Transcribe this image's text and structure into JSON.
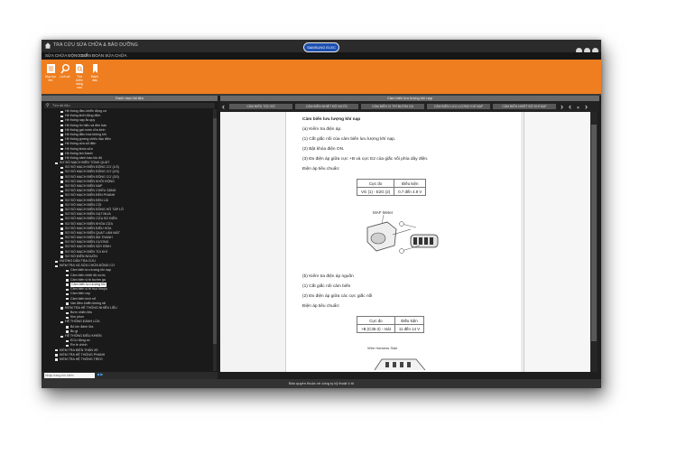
{
  "window": {
    "title": "TRA CỨU SỬA CHỮA & BẢO DƯỠNG",
    "brand_logo": "SAMSUNG ELEC",
    "controls": [
      "minimize",
      "maximize",
      "close"
    ]
  },
  "menu": [
    "SỬA CHỮA ĐỘNG CƠ",
    "CHẨN ĐOÁN SỬA CHỮA"
  ],
  "toolbar": [
    {
      "label": "Mục lục tìm",
      "icon": "book-icon"
    },
    {
      "label": "Lịch sử",
      "icon": "search-icon"
    },
    {
      "label": "Tìm kiếm nâng cao",
      "icon": "document-search-icon"
    },
    {
      "label": "Đánh dấu",
      "icon": "bookmark-icon"
    }
  ],
  "left_panel": {
    "header": "Danh mục tài liệu",
    "search_placeholder": "Tìm tài liệu",
    "footer_placeholder": "Nhập trang tìm kiếm"
  },
  "tree": [
    {
      "label": "Hệ thống điều khiển động cơ",
      "indent": 2
    },
    {
      "label": "Hệ thống khởi động điện",
      "indent": 2
    },
    {
      "label": "Hệ thống nạp ắc quy",
      "indent": 2
    },
    {
      "label": "Hệ thống tín hiệu và đèn báo",
      "indent": 2
    },
    {
      "label": "Hệ thống gạt nước rửa kính",
      "indent": 2
    },
    {
      "label": "Hệ thống điều hòa không khí",
      "indent": 2
    },
    {
      "label": "Hệ thống gương chiếu hậu điện",
      "indent": 2
    },
    {
      "label": "Hệ thống cửa sổ điện",
      "indent": 2
    },
    {
      "label": "Hệ thống khóa cửa",
      "indent": 2
    },
    {
      "label": "Hệ thống âm thanh",
      "indent": 2
    },
    {
      "label": "Hệ thống cảnh báo tốc độ",
      "indent": 2
    },
    {
      "label": "SƠ ĐỒ MẠCH ĐIỆN TỔNG QUÁT",
      "indent": 1
    },
    {
      "label": "SƠ ĐỒ MẠCH ĐIỆN ĐỘNG CƠ (1/3)",
      "indent": 2
    },
    {
      "label": "SƠ ĐỒ MẠCH ĐIỆN ĐỘNG CƠ (2/3)",
      "indent": 2
    },
    {
      "label": "SƠ ĐỒ MẠCH ĐIỆN ĐỘNG CƠ (3/3)",
      "indent": 2
    },
    {
      "label": "SƠ ĐỒ MẠCH ĐIỆN KHỞI ĐỘNG",
      "indent": 2
    },
    {
      "label": "SƠ ĐỒ MẠCH ĐIỆN NẠP",
      "indent": 2
    },
    {
      "label": "SƠ ĐỒ MẠCH ĐIỆN CHIẾU SÁNG",
      "indent": 2
    },
    {
      "label": "SƠ ĐỒ MẠCH ĐIỆN ĐÈN PHANH",
      "indent": 2
    },
    {
      "label": "SƠ ĐỒ MẠCH ĐIỆN ĐÈN LÙI",
      "indent": 2
    },
    {
      "label": "SƠ ĐỒ MẠCH ĐIỆN CÒI",
      "indent": 2
    },
    {
      "label": "SƠ ĐỒ MẠCH ĐIỆN ĐỒNG HỒ TÁP LÔ",
      "indent": 2
    },
    {
      "label": "SƠ ĐỒ MẠCH ĐIỆN GẠT MƯA",
      "indent": 2
    },
    {
      "label": "SƠ ĐỒ MẠCH ĐIỆN CỬA SỔ ĐIỆN",
      "indent": 2
    },
    {
      "label": "SƠ ĐỒ MẠCH ĐIỆN KHÓA CỬA",
      "indent": 2
    },
    {
      "label": "SƠ ĐỒ MẠCH ĐIỆN ĐIỀU HÒA",
      "indent": 2
    },
    {
      "label": "SƠ ĐỒ MẠCH ĐIỆN QUẠT LÀM MÁT",
      "indent": 2
    },
    {
      "label": "SƠ ĐỒ MẠCH ĐIỆN ÂM THANH",
      "indent": 2
    },
    {
      "label": "SƠ ĐỒ MẠCH ĐIỆN GƯƠNG",
      "indent": 2
    },
    {
      "label": "SƠ ĐỒ MẠCH ĐIỆN SẤY KÍNH",
      "indent": 2
    },
    {
      "label": "SƠ ĐỒ MẠCH ĐIỆN TÚI KHÍ",
      "indent": 2
    },
    {
      "label": "SƠ ĐỒ ĐIỆN NGUỒN",
      "indent": 2
    },
    {
      "label": "HƯỚNG DẪN TRA CỨU",
      "indent": 1
    },
    {
      "label": "KIỂM TRA VÀ SỬA CHỮA ĐỘNG CƠ",
      "indent": 1
    },
    {
      "label": "Cảm biến lưu lượng khí nạp",
      "indent": 3
    },
    {
      "label": "Cảm biến nhiệt độ nước",
      "indent": 3
    },
    {
      "label": "Cảm biến vị trí bướm ga",
      "indent": 3
    },
    {
      "label": "Cảm biến lưu lượng khí",
      "indent": 3,
      "selected": true
    },
    {
      "label": "Cảm biến vị trí trục khuỷu",
      "indent": 3
    },
    {
      "label": "Cảm biến oxy",
      "indent": 3
    },
    {
      "label": "Cảm biến kích nổ",
      "indent": 3
    },
    {
      "label": "Van điều khiển không tải",
      "indent": 3
    },
    {
      "label": "KIỂM TRA HỆ THỐNG NHIÊN LIỆU",
      "indent": 2
    },
    {
      "label": "Bơm nhiên liệu",
      "indent": 3
    },
    {
      "label": "Kim phun",
      "indent": 3
    },
    {
      "label": "HỆ THỐNG ĐÁNH LỬA",
      "indent": 2
    },
    {
      "label": "Bô bin đánh lửa",
      "indent": 3
    },
    {
      "label": "Bu gi",
      "indent": 3
    },
    {
      "label": "HỆ THỐNG ĐIỀU KHIỂN",
      "indent": 2
    },
    {
      "label": "ECU động cơ",
      "indent": 3
    },
    {
      "label": "Rơ le chính",
      "indent": 3
    },
    {
      "label": "KIỂM TRA ĐIỆN THÂN XE",
      "indent": 1
    },
    {
      "label": "KIỂM TRA HỆ THỐNG PHANH",
      "indent": 1
    },
    {
      "label": "KIỂM TRA HỆ THỐNG TREO",
      "indent": 1
    }
  ],
  "doc_header": "Cảm biến lưu lượng khí nạp",
  "tabs": [
    "CẢM BIẾN TỐC ĐỘ",
    "CẢM BIẾN NHIỆT ĐỘ NƯỚC",
    "CẢM BIẾN VỊ TRÍ BƯỚM GA",
    "CẢM BIẾN LƯU LƯỢNG KHÍ NẠP",
    "CẢM BIẾN NHIỆT ĐỘ KHÍ NẠP"
  ],
  "document": {
    "heading": "Cảm biến lưu lượng khí nạp",
    "p1": "(a) Kiểm tra điện áp.",
    "p2": "(1) Cắt giắc nối của cảm biến lưu lượng khí nạp.",
    "p3": "(2) Bật khóa điện ON.",
    "p4": "(3) Đo điện áp giữa cực +B và cực E2 của giắc nối phía dây điện.",
    "p5": "Điện áp tiêu chuẩn:",
    "table1": {
      "h1": "Cực đo",
      "h2": "Điều kiện",
      "c1": "VG (1) - E2G (2)",
      "c2": "0.7 đến 4.9 V"
    },
    "fig1_label": "MAF Meter",
    "p6": "(b) Kiểm tra điện áp nguồn",
    "p7": "(1) Cắt giắc nối cảm biến",
    "p8": "(2) Đo điện áp giữa các cực giắc nối",
    "p9": "Điện áp tiêu chuẩn:",
    "table2": {
      "h1": "Cực đo",
      "h2": "Điều kiện",
      "c1": "+B (C35-2) - mát",
      "c2": "11 đến 14 V"
    },
    "fig2_label": "Wire Harness Side"
  },
  "status": "Bản quyền thuộc về công ty kỹ thuật ô tô"
}
